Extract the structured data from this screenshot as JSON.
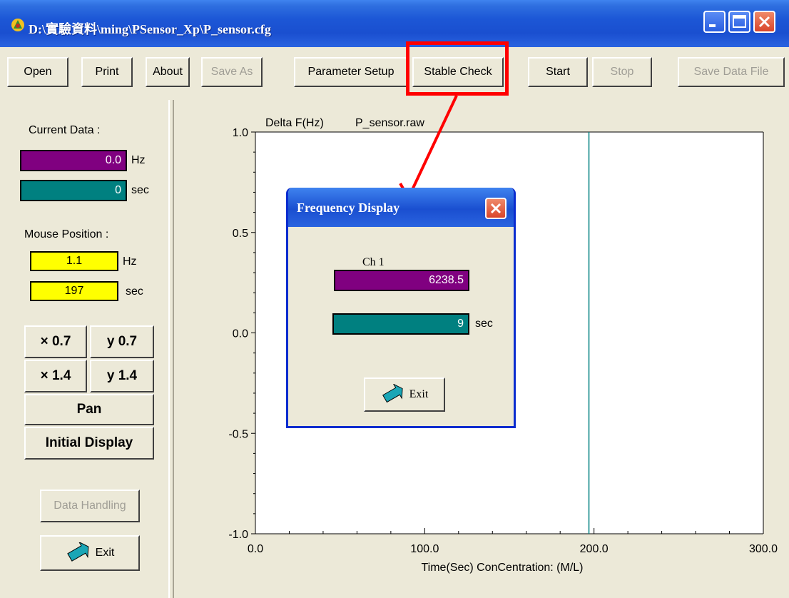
{
  "window": {
    "title": "D:\\實驗資料\\ming\\PSensor_Xp\\P_sensor.cfg",
    "title_icon": "app-icon",
    "controls": [
      "minimize-icon",
      "maximize-icon",
      "close-icon"
    ]
  },
  "toolbar": {
    "open": "Open",
    "print": "Print",
    "about": "About",
    "save_as": "Save As",
    "parameter_setup": "Parameter Setup",
    "stable_check": "Stable Check",
    "start": "Start",
    "stop": "Stop",
    "save_data_file": "Save Data File"
  },
  "left_panel": {
    "current_data_label": "Current Data :",
    "current_hz_value": "0.0",
    "hz_unit": "Hz",
    "current_sec_value": "0",
    "sec_unit": "sec",
    "mouse_position_label": "Mouse Position :",
    "mouse_hz_value": "1.1",
    "mouse_sec_value": "197",
    "x07": "× 0.7",
    "y07": "y 0.7",
    "x14": "× 1.4",
    "y14": "y 1.4",
    "pan": "Pan",
    "initial_display": "Initial Display",
    "data_handling": "Data Handling",
    "exit": "Exit"
  },
  "chart_data": {
    "type": "line",
    "title": "P_sensor.raw",
    "xlabel": "Time(Sec)  ConCentration:  (M/L)",
    "ylabel": "Delta F(Hz)",
    "xlim": [
      0,
      300
    ],
    "ylim": [
      -1,
      1
    ],
    "x_ticks": [
      "0.0",
      "100.0",
      "200.0",
      "300.0"
    ],
    "y_ticks": [
      "1.0",
      "0.5",
      "0.0",
      "-0.5",
      "-1.0"
    ],
    "cursor_x": 197,
    "grid": false
  },
  "dialog": {
    "title": "Frequency Display",
    "channel_label": "Ch 1",
    "freq_value": "6238.5",
    "sec_value": "9",
    "sec_unit": "sec",
    "exit": "Exit"
  },
  "colors": {
    "purple": "#800080",
    "teal": "#008080",
    "yellow": "#ffff00",
    "annotation_red": "#ff0000"
  }
}
